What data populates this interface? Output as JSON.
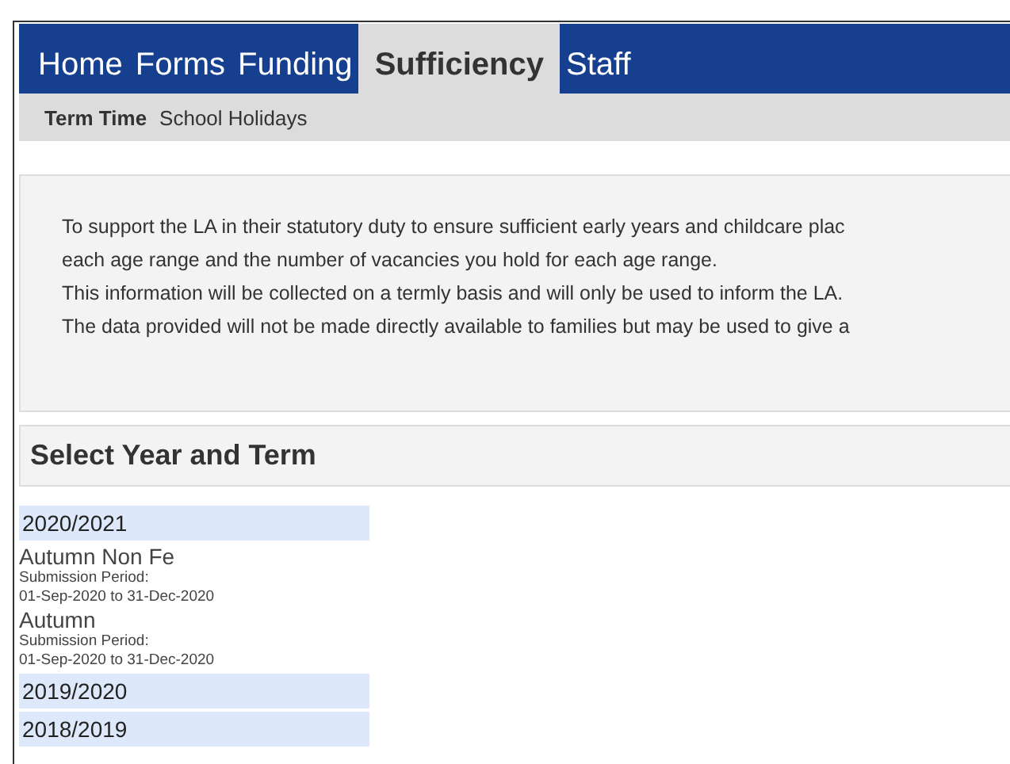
{
  "tabs": [
    {
      "label": "Home",
      "selected": false
    },
    {
      "label": "Forms",
      "selected": false
    },
    {
      "label": "Funding",
      "selected": false
    },
    {
      "label": "Sufficiency",
      "selected": true
    },
    {
      "label": "Staff",
      "selected": false
    }
  ],
  "subtabs": [
    {
      "label": "Term Time",
      "selected": true
    },
    {
      "label": "School Holidays",
      "selected": false
    }
  ],
  "info_lines": [
    "To support the LA in their statutory duty to ensure sufficient early years and childcare plac",
    "each age range and the number of vacancies you hold for each age range.",
    "This information will be collected on a termly basis and will only be used to inform the LA.",
    "The data provided will not be made directly available to families but may be used to give a"
  ],
  "section_title": "Select Year and Term",
  "years": [
    {
      "label": "2020/2021",
      "terms": [
        {
          "name": "Autumn Non Fe",
          "period_label": "Submission Period:",
          "period": "01-Sep-2020 to 31-Dec-2020"
        },
        {
          "name": "Autumn",
          "period_label": "Submission Period:",
          "period": "01-Sep-2020 to 31-Dec-2020"
        }
      ]
    },
    {
      "label": "2019/2020"
    },
    {
      "label": "2018/2019"
    }
  ]
}
